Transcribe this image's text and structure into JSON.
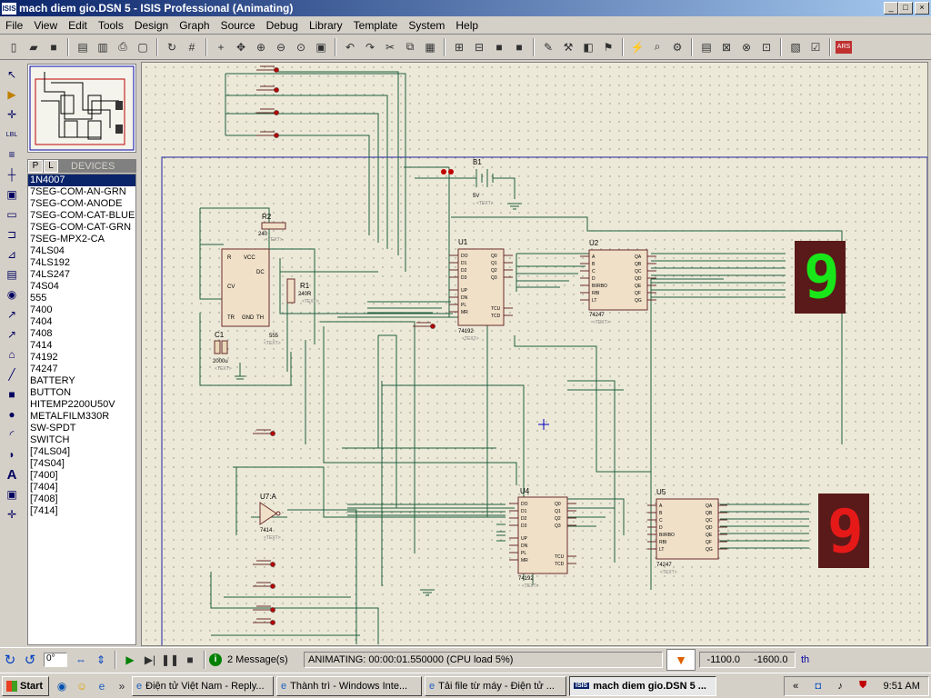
{
  "window": {
    "title": "mach diem gio.DSN 5 - ISIS Professional (Animating)",
    "app_badge": "ISIS"
  },
  "menu": [
    "File",
    "View",
    "Edit",
    "Tools",
    "Design",
    "Graph",
    "Source",
    "Debug",
    "Library",
    "Template",
    "System",
    "Help"
  ],
  "devices": {
    "tabs": [
      "P",
      "L"
    ],
    "header": "DEVICES",
    "items": [
      "1N4007",
      "7SEG-COM-AN-GRN",
      "7SEG-COM-ANODE",
      "7SEG-COM-CAT-BLUE",
      "7SEG-COM-CAT-GRN",
      "7SEG-MPX2-CA",
      "74LS04",
      "74LS192",
      "74LS247",
      "74S04",
      "555",
      "7400",
      "7404",
      "7408",
      "7414",
      "74192",
      "74247",
      "BATTERY",
      "BUTTON",
      "HITEMP2200U50V",
      "METALFILM330R",
      "SW-SPDT",
      "SWITCH",
      "[74LS04]",
      "[74S04]",
      "[7400]",
      "[7404]",
      "[7408]",
      "[7414]"
    ],
    "selected": "1N4007"
  },
  "schematic": {
    "u1": {
      "ref": "U1",
      "part": "74192",
      "pins_left": [
        "DO",
        "D1",
        "D2",
        "D3",
        "UP",
        "DN",
        "PL",
        "MR"
      ],
      "pins_right": [
        "Q0",
        "Q1",
        "Q2",
        "Q3",
        "TCU",
        "TCD"
      ]
    },
    "u2": {
      "ref": "U2",
      "part": "74247",
      "pins_left": [
        "A",
        "B",
        "C",
        "D",
        "BI/RBO",
        "RBI",
        "LT"
      ],
      "pins_right": [
        "QA",
        "QB",
        "QC",
        "QD",
        "QE",
        "QF",
        "QG"
      ]
    },
    "u4": {
      "ref": "U4",
      "part": "74192",
      "pins_left": [
        "DO",
        "D1",
        "D2",
        "D3",
        "UP",
        "DN",
        "PL",
        "MR"
      ],
      "pins_right": [
        "Q0",
        "Q1",
        "Q2",
        "Q3",
        "TCU",
        "TCD"
      ]
    },
    "u5": {
      "ref": "U5",
      "part": "74247",
      "pins_left": [
        "A",
        "B",
        "C",
        "D",
        "BI/RBO",
        "RBI",
        "LT"
      ],
      "pins_right": [
        "QA",
        "QB",
        "QC",
        "QD",
        "QE",
        "QF",
        "QG"
      ]
    },
    "timer": {
      "part": "555",
      "pins": [
        "R",
        "VCC",
        "DC",
        "CV",
        "TR",
        "TH",
        "GND"
      ]
    },
    "r1": {
      "ref": "R1",
      "value": "240R"
    },
    "r2": {
      "ref": "R2",
      "value": "240"
    },
    "c1": {
      "ref": "C1",
      "value": "2000u"
    },
    "b1": {
      "ref": "B1",
      "value": "5V"
    },
    "u7": {
      "ref": "U7:A",
      "part": "7414"
    },
    "text_tag": "<TEXT>",
    "display_top": {
      "digit": "9",
      "color": "#19e619"
    },
    "display_bottom": {
      "digit": "9",
      "color": "#e61919"
    }
  },
  "status": {
    "rotation": "0°",
    "messages": "2 Message(s)",
    "animating": "ANIMATING: 00:00:01.550000 (CPU load 5%)",
    "coord_x": "-1100.0",
    "coord_y": "-1600.0",
    "unit": "th"
  },
  "taskbar": {
    "start": "Start",
    "tasks": [
      "Điện tử Việt Nam - Reply...",
      "Thành trì - Windows Inte...",
      "Tải file từ máy - Điện tử ...",
      "mach diem gio.DSN 5 ..."
    ],
    "clock": "9:51 AM"
  }
}
